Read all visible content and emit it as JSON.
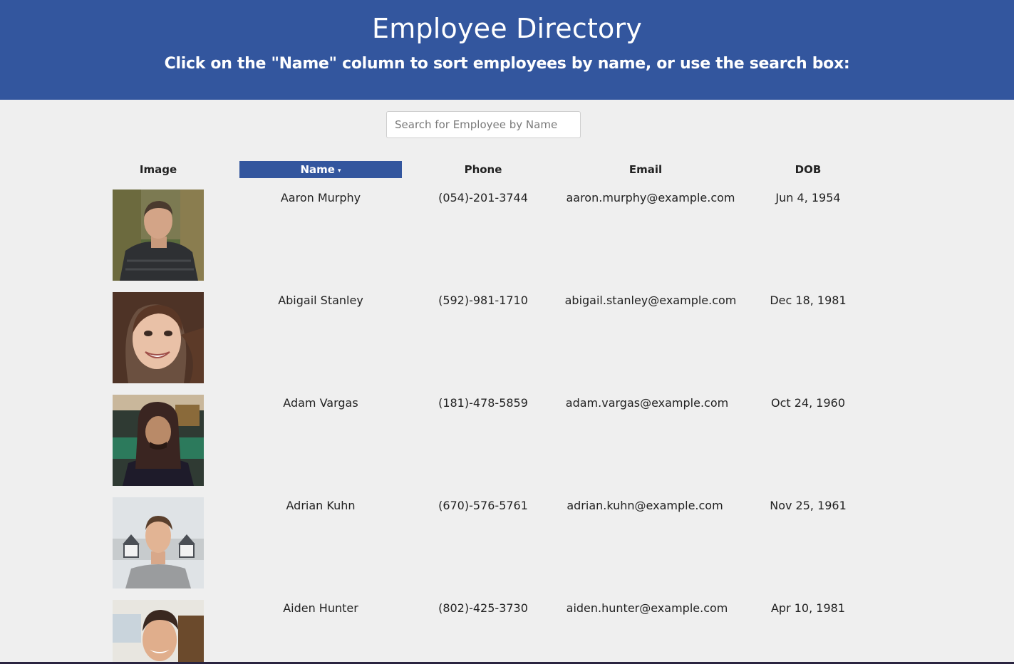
{
  "header": {
    "title": "Employee Directory",
    "subtitle": "Click on the \"Name\" column to sort employees by name, or use the search box:"
  },
  "search": {
    "placeholder": "Search for Employee by Name",
    "value": ""
  },
  "columns": {
    "image": "Image",
    "name": "Name",
    "name_sort_indicator": "▾",
    "phone": "Phone",
    "email": "Email",
    "dob": "DOB"
  },
  "colors": {
    "brand": "#33569e",
    "background": "#efefef"
  },
  "employees": [
    {
      "name": "Aaron Murphy",
      "phone": "(054)-201-3744",
      "email": "aaron.murphy@example.com",
      "dob": "Jun 4, 1954",
      "photo": "man-in-puffer-jacket-photo"
    },
    {
      "name": "Abigail Stanley",
      "phone": "(592)-981-1710",
      "email": "abigail.stanley@example.com",
      "dob": "Dec 18, 1981",
      "photo": "smiling-woman-photo"
    },
    {
      "name": "Adam Vargas",
      "phone": "(181)-478-5859",
      "email": "adam.vargas@example.com",
      "dob": "Oct 24, 1960",
      "photo": "man-with-dreadlocks-photo"
    },
    {
      "name": "Adrian Kuhn",
      "phone": "(670)-576-5761",
      "email": "adrian.kuhn@example.com",
      "dob": "Nov 25, 1961",
      "photo": "man-by-beach-huts-photo"
    },
    {
      "name": "Aiden Hunter",
      "phone": "(802)-425-3730",
      "email": "aiden.hunter@example.com",
      "dob": "Apr 10, 1981",
      "photo": "man-in-office-photo"
    }
  ]
}
